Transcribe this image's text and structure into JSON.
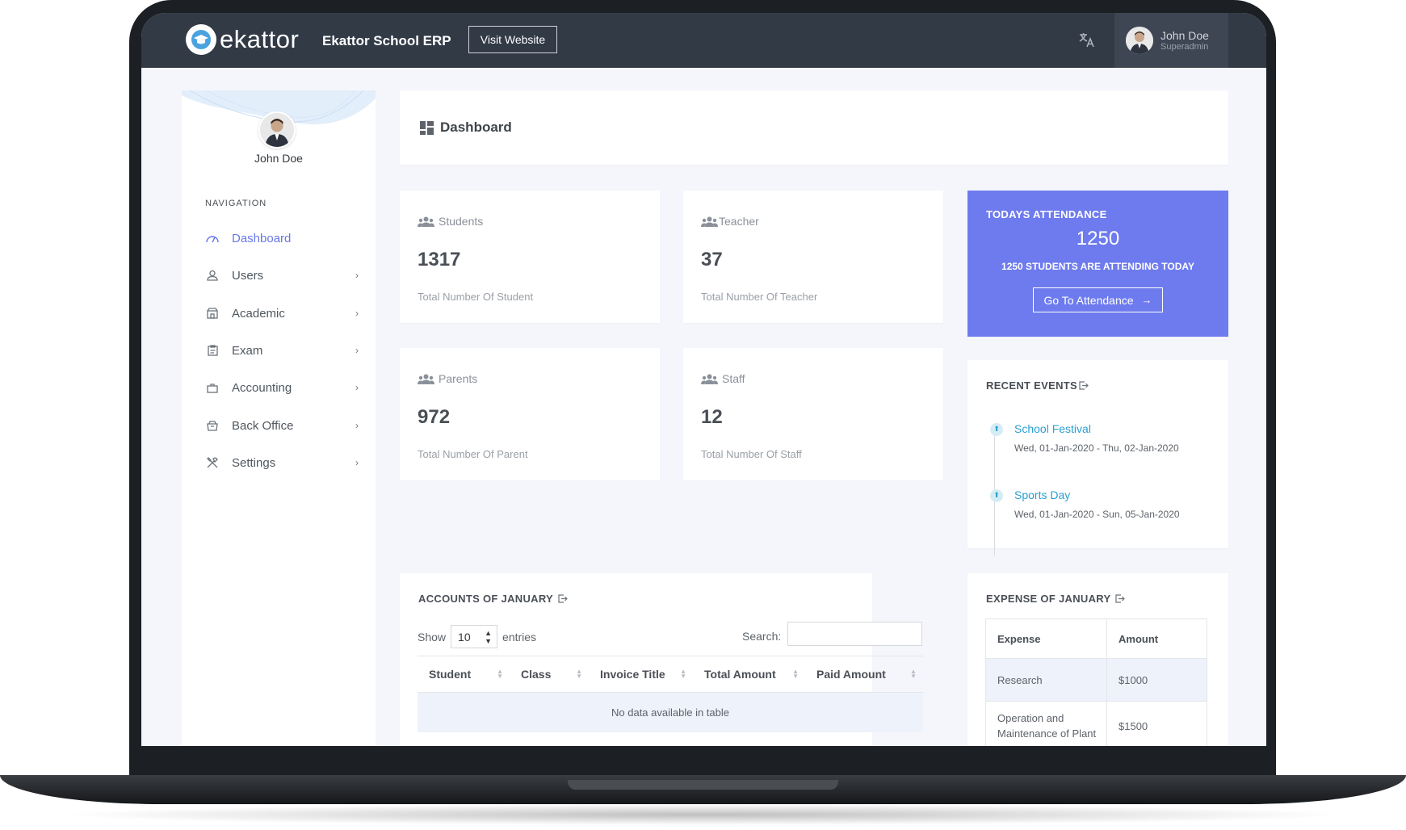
{
  "header": {
    "logo_text": "ekattor",
    "app_title": "Ekattor School ERP",
    "visit_label": "Visit Website",
    "user_name": "John Doe",
    "user_role": "Superadmin"
  },
  "sidebar": {
    "user_name": "John Doe",
    "nav_title": "NAVIGATION",
    "items": [
      {
        "label": "Dashboard",
        "icon": "dashboard-icon",
        "active": true
      },
      {
        "label": "Users",
        "icon": "user-icon"
      },
      {
        "label": "Academic",
        "icon": "school-icon"
      },
      {
        "label": "Exam",
        "icon": "clipboard-icon"
      },
      {
        "label": "Accounting",
        "icon": "briefcase-icon"
      },
      {
        "label": "Back Office",
        "icon": "box-icon"
      },
      {
        "label": "Settings",
        "icon": "tools-icon"
      }
    ]
  },
  "page": {
    "title": "Dashboard"
  },
  "stats": {
    "students": {
      "label": "Students",
      "value": "1317",
      "sub": "Total Number Of Student"
    },
    "teacher": {
      "label": "Teacher",
      "value": "37",
      "sub": "Total Number Of Teacher"
    },
    "parents": {
      "label": "Parents",
      "value": "972",
      "sub": "Total Number Of Parent"
    },
    "staff": {
      "label": "Staff",
      "value": "12",
      "sub": "Total Number Of Staff"
    }
  },
  "attendance": {
    "title": "TODAYS ATTENDANCE",
    "value": "1250",
    "sub": "1250 STUDENTS ARE ATTENDING TODAY",
    "button": "Go To Attendance"
  },
  "events": {
    "title": "RECENT EVENTS",
    "items": [
      {
        "name": "School Festival",
        "date": "Wed, 01-Jan-2020 - Thu, 02-Jan-2020"
      },
      {
        "name": "Sports Day",
        "date": "Wed, 01-Jan-2020 - Sun, 05-Jan-2020"
      }
    ]
  },
  "accounts": {
    "title": "ACCOUNTS OF JANUARY",
    "show_label": "Show",
    "entries_value": "10",
    "entries_label": "entries",
    "search_label": "Search:",
    "columns": [
      "Student",
      "Class",
      "Invoice Title",
      "Total Amount",
      "Paid Amount"
    ],
    "empty_text": "No data available in table"
  },
  "expense": {
    "title": "EXPENSE OF JANUARY",
    "columns": [
      "Expense",
      "Amount"
    ],
    "rows": [
      {
        "expense": "Research",
        "amount": "$1000"
      },
      {
        "expense": "Operation and Maintenance of Plant",
        "amount": "$1500"
      }
    ]
  },
  "colors": {
    "accent": "#6e7bee",
    "topbar": "#323a46",
    "link": "#2a9ed1"
  }
}
